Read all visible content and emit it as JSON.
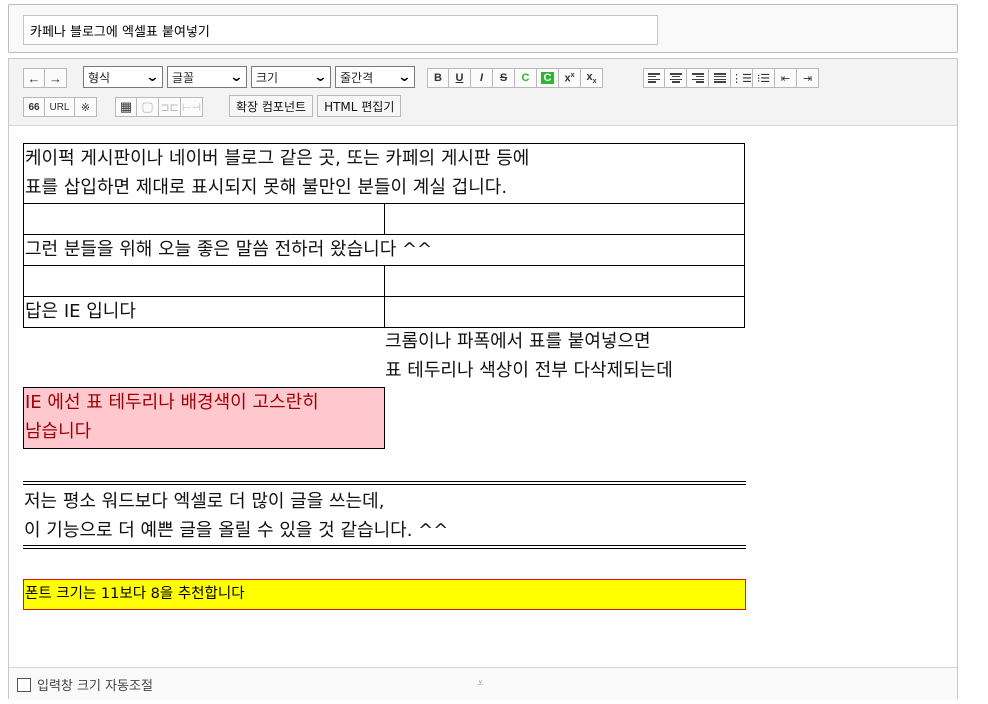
{
  "title": {
    "value": "카페나 블로그에 엑셀표 붙여넣기"
  },
  "toolbar": {
    "undo": "←",
    "redo": "→",
    "format_select": "형식",
    "font_select": "글꼴",
    "size_select": "크기",
    "line_height_select": "줄간격",
    "bold": "B",
    "underline": "U",
    "italic": "I",
    "strike": "S",
    "font_color": "C",
    "bg_color": "C",
    "superscript": "x",
    "subscript": "x",
    "quote": "66",
    "url": "URL",
    "special_char": "※",
    "extend_component": "확장 컴포넌트",
    "html_edit": "HTML 편집기"
  },
  "content": {
    "intro_line1": "케이퍽 게시판이나 네이버 블로그 같은 곳, 또는 카페의 게시판 등에",
    "intro_line2": "표를 삽입하면 제대로 표시되지 못해 불만인 분들이 계실 겁니다.",
    "line_for_you": "그런 분들을 위해 오늘 좋은 말씀 전하러 왔습니다 ^^",
    "answer": "답은 IE 입니다",
    "chrome_line1": "크롬이나 파폭에서 표를 붙여넣으면",
    "chrome_line2": "표 테두리나 색상이 전부 다삭제되는데",
    "ie_line1": "IE 에선 표 테두리나 배경색이 고스란히",
    "ie_line2": "남습니다",
    "excel_line1": "저는 평소 워드보다 엑셀로 더 많이 글을 쓰는데,",
    "excel_line2": "이 기능으로 더 예쁜 글을 올릴 수 있을 것 같습니다. ^^",
    "font_tip": "폰트 크기는 11보다 8을 추천합니다"
  },
  "footer": {
    "autosize_label": "입력창 크기 자동조절"
  },
  "colors": {
    "ie_cell_bg": "#ffc7ce",
    "ie_cell_text": "#9c0006",
    "tip_bg": "#ffff00",
    "tip_border": "#e01010",
    "green_accent": "#2fb52f"
  }
}
